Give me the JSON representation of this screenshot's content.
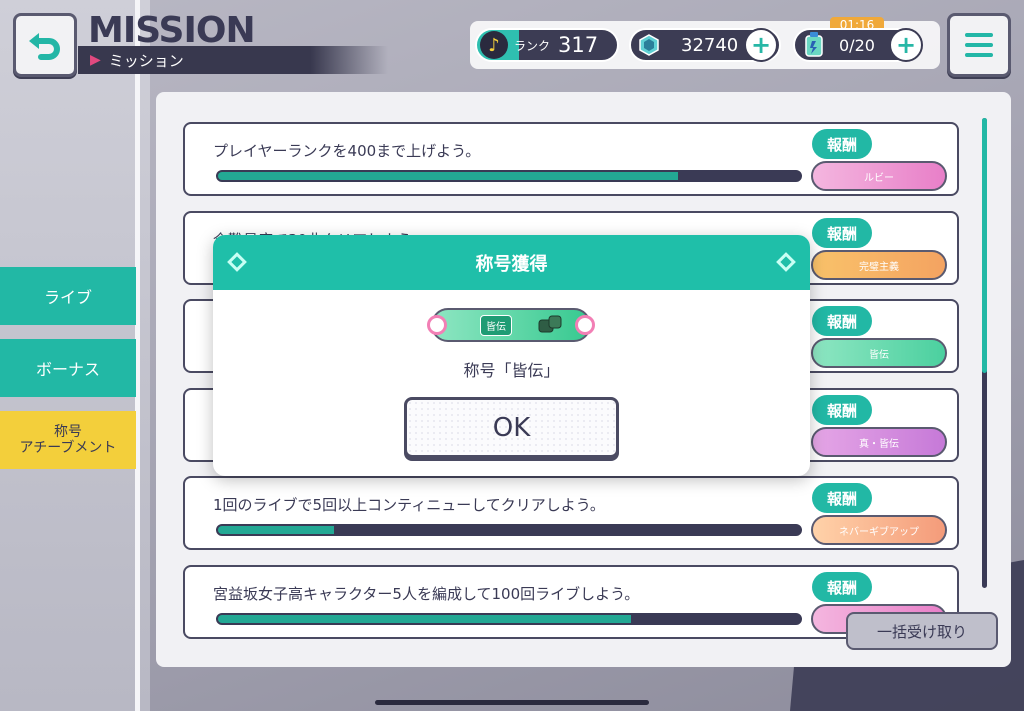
{
  "header": {
    "title": "MISSION",
    "subtitle": "ミッション"
  },
  "status": {
    "rank_label": "ランク",
    "rank_value": "317",
    "gems": "32740",
    "energy": "0/20",
    "timer": "01:16"
  },
  "tabs": [
    {
      "label": "ライブ"
    },
    {
      "label": "ボーナス"
    },
    {
      "label_line1": "称号",
      "label_line2": "アチーブメント"
    }
  ],
  "missions": [
    {
      "text": "プレイヤーランクを400まで上げよう。",
      "progress": 0.79,
      "reward_label": "報酬",
      "reward_item": "ルビー",
      "reward_style": "ruby"
    },
    {
      "text": "全難易度で30曲クリアしよう。",
      "progress": 0.0,
      "reward_label": "報酬",
      "reward_item": "完璧主義",
      "reward_style": "gold"
    },
    {
      "text": "",
      "progress": 0.0,
      "reward_label": "報酬",
      "reward_item": "皆伝",
      "reward_style": "green"
    },
    {
      "text": "",
      "progress": 0.0,
      "reward_label": "報酬",
      "reward_item": "真・皆伝",
      "reward_style": "purple"
    },
    {
      "text": "1回のライブで5回以上コンティニューしてクリアしよう。",
      "progress": 0.2,
      "reward_label": "報酬",
      "reward_item": "ネバーギブアップ",
      "reward_style": "orange"
    },
    {
      "text": "宮益坂女子高キャラクター5人を編成して100回ライブしよう。",
      "progress": 0.71,
      "reward_label": "報酬",
      "reward_item": "",
      "reward_style": "pink"
    }
  ],
  "bulk_button": "一括受け取り",
  "dialog": {
    "title": "称号獲得",
    "badge_tag": "皆伝",
    "message": "称号「皆伝」",
    "ok": "OK"
  },
  "colors": {
    "accent": "#22b8a5",
    "dark": "#3a3a55",
    "yellow": "#f3cf3b"
  }
}
